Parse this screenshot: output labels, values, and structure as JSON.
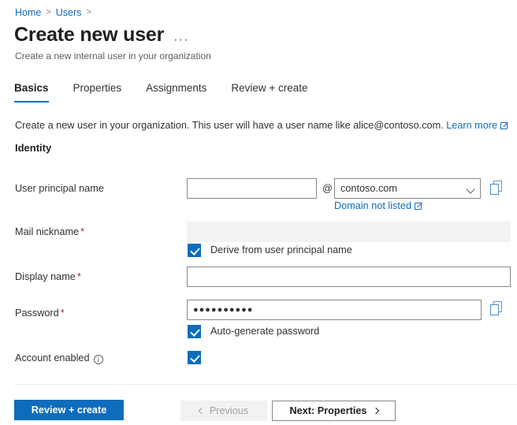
{
  "breadcrumb": {
    "items": [
      {
        "label": "Home"
      },
      {
        "label": "Users"
      }
    ],
    "separator": ">",
    "trailing_separator": ">"
  },
  "header": {
    "title": "Create new user",
    "ellipsis": "···",
    "subtitle": "Create a new internal user in your organization"
  },
  "tabs": [
    {
      "label": "Basics",
      "active": true
    },
    {
      "label": "Properties",
      "active": false
    },
    {
      "label": "Assignments",
      "active": false
    },
    {
      "label": "Review + create",
      "active": false
    }
  ],
  "intro": {
    "text": "Create a new user in your organization. This user will have a user name like alice@contoso.com.",
    "link_label": "Learn more",
    "link_icon": "external-link-icon"
  },
  "section": {
    "heading": "Identity"
  },
  "fields": {
    "user_principal_name": {
      "label": "User principal name",
      "required": false,
      "value": "",
      "placeholder": "",
      "at_symbol": "@",
      "domain_selected": "contoso.com",
      "domain_options": [
        "contoso.com"
      ],
      "sublink_label": "Domain not listed",
      "copy_icon": "copy-to-clipboard-icon"
    },
    "mail_nickname": {
      "label": "Mail nickname",
      "required": true,
      "required_marker": "*",
      "value": "",
      "disabled": true,
      "checkbox_label": "Derive from user principal name",
      "checkbox_checked": true
    },
    "display_name": {
      "label": "Display name",
      "required": true,
      "required_marker": "*",
      "value": "",
      "placeholder": ""
    },
    "password": {
      "label": "Password",
      "required": true,
      "required_marker": "*",
      "value": "●●●●●●●●●●",
      "checkbox_label": "Auto-generate password",
      "checkbox_checked": true,
      "copy_icon": "copy-to-clipboard-icon"
    },
    "account_enabled": {
      "label": "Account enabled",
      "info_icon": "info-circle-icon",
      "info_glyph": "i",
      "checkbox_checked": true
    }
  },
  "footer": {
    "review_create_label": "Review + create",
    "previous_label": "Previous",
    "next_label": "Next: Properties"
  },
  "colors": {
    "accent": "#0f6cbd",
    "link": "#0f6cbd",
    "required": "#a4262c",
    "disabled_bg": "#f3f2f1",
    "border": "#8a8886",
    "copy_icon": "#5b9bd5"
  }
}
